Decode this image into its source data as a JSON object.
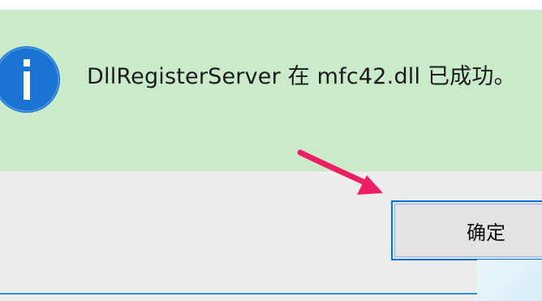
{
  "dialog": {
    "message": "DllRegisterServer 在 mfc42.dll 已成功。",
    "ok_label": "确定",
    "icon": "info-icon",
    "colors": {
      "content_background": "#c9ebca",
      "footer_background": "#ededed",
      "icon_blue": "#1b74d1",
      "button_border": "#0a6fd6",
      "annotation_arrow": "#ee1f63"
    }
  },
  "annotation": {
    "icon": "arrow-annotation-icon"
  }
}
